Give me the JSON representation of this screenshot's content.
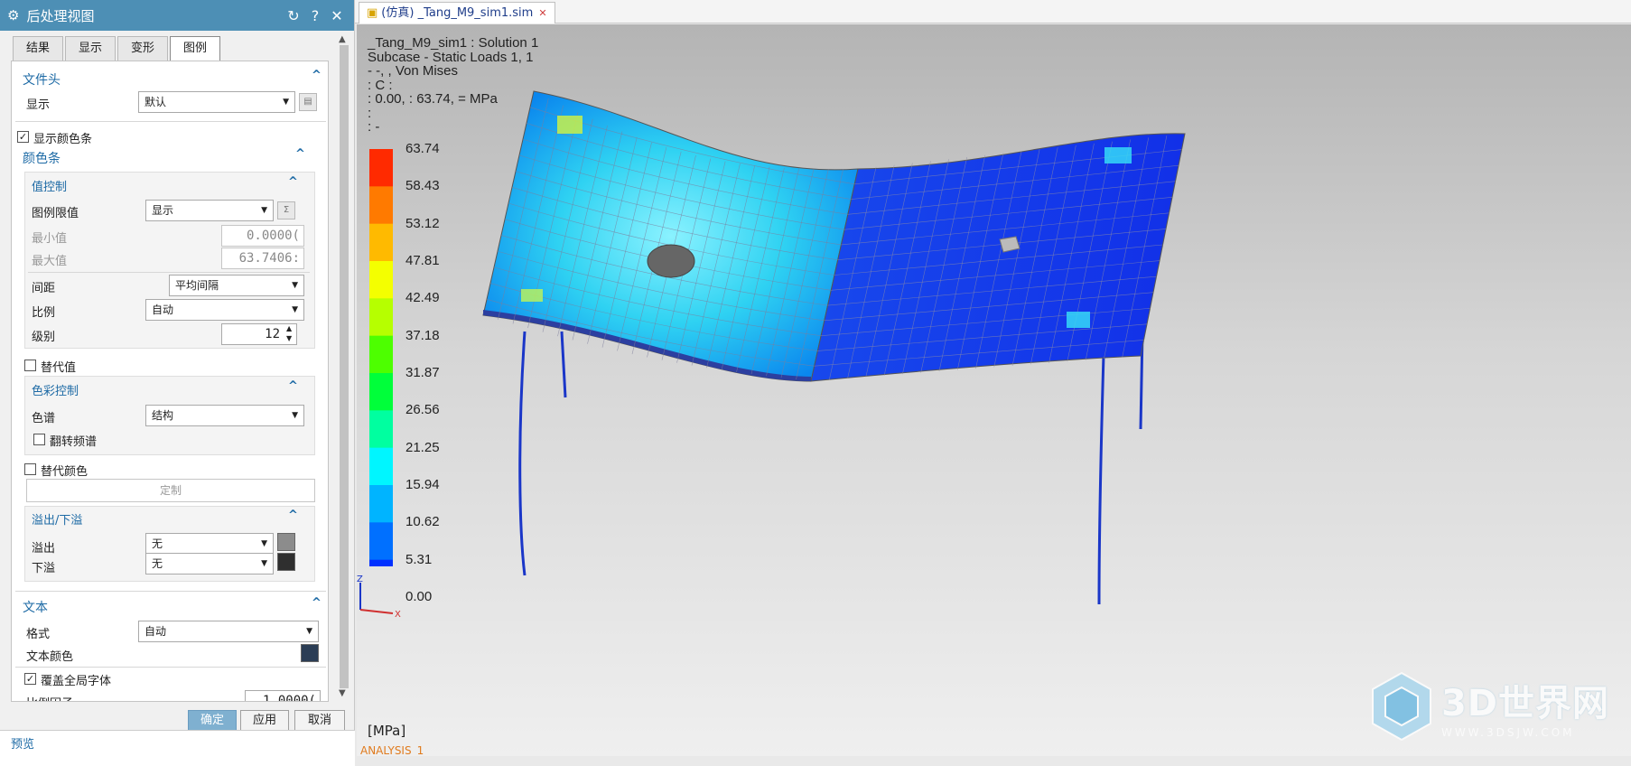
{
  "dialog": {
    "title": "后处理视图",
    "tabs": [
      "结果",
      "显示",
      "变形",
      "图例"
    ],
    "active_tab": "图例",
    "file_header": {
      "section": "文件头",
      "display_label": "显示",
      "display_value": "默认"
    },
    "show_colorbar": {
      "label": "显示颜色条",
      "checked": true
    },
    "colorbar": {
      "section": "颜色条",
      "value_control": "值控制",
      "legend_limit_label": "图例限值",
      "legend_limit_value": "显示",
      "min_label": "最小值",
      "min_value": "0.0000(",
      "max_label": "最大值",
      "max_value": "63.7406:",
      "spacing_label": "间距",
      "spacing_value": "平均间隔",
      "scale_label": "比例",
      "scale_value": "自动",
      "levels_label": "级别",
      "levels_value": "12"
    },
    "alt_value": {
      "label": "替代值",
      "checked": false
    },
    "color_control": {
      "section": "色彩控制",
      "spectrum_label": "色谱",
      "spectrum_value": "结构",
      "flip_label": "翻转频谱",
      "flip_checked": false
    },
    "alt_color": {
      "label": "替代颜色",
      "checked": false
    },
    "customize_label": "定制",
    "overflow": {
      "section": "溢出/下溢",
      "overflow_label": "溢出",
      "overflow_value": "无",
      "overflow_color": "#8c8c8c",
      "underflow_label": "下溢",
      "underflow_value": "无",
      "underflow_color": "#2f2f2f"
    },
    "text": {
      "section": "文本",
      "format_label": "格式",
      "format_value": "自动",
      "color_label": "文本颜色",
      "color": "#2b3d55",
      "override_font_label": "覆盖全局字体",
      "override_checked": true,
      "scale_factor_label": "比例因子",
      "scale_factor_value": "1.0000("
    },
    "buttons": {
      "ok": "确定",
      "apply": "应用",
      "cancel": "取消"
    },
    "preview_label": "预览"
  },
  "viewport": {
    "tab_title": "(仿真) _Tang_M9_sim1.sim",
    "header_lines": [
      "_Tang_M9_sim1 : Solution 1",
      "Subcase - Static Loads 1,  1",
      " - -, , Von Mises",
      " :  C :",
      " : 0.00,  : 63.74,  = MPa",
      " :",
      " :  -"
    ],
    "legend_values": [
      "63.74",
      "58.43",
      "53.12",
      "47.81",
      "42.49",
      "37.18",
      "31.87",
      "26.56",
      "21.25",
      "15.94",
      "10.62",
      "5.31",
      "0.00"
    ],
    "unit_label": "[MPa]",
    "analysis_label": "ANALYSIS_1",
    "triad": {
      "z": "Z",
      "x": "X"
    },
    "watermark": {
      "brand": "3D世界网",
      "url": "WWW.3DSJW.COM"
    },
    "colors": {
      "accent": "#4d8fb5",
      "mesh_blue": "#1f45e6",
      "beam": "#1a36c8"
    }
  }
}
